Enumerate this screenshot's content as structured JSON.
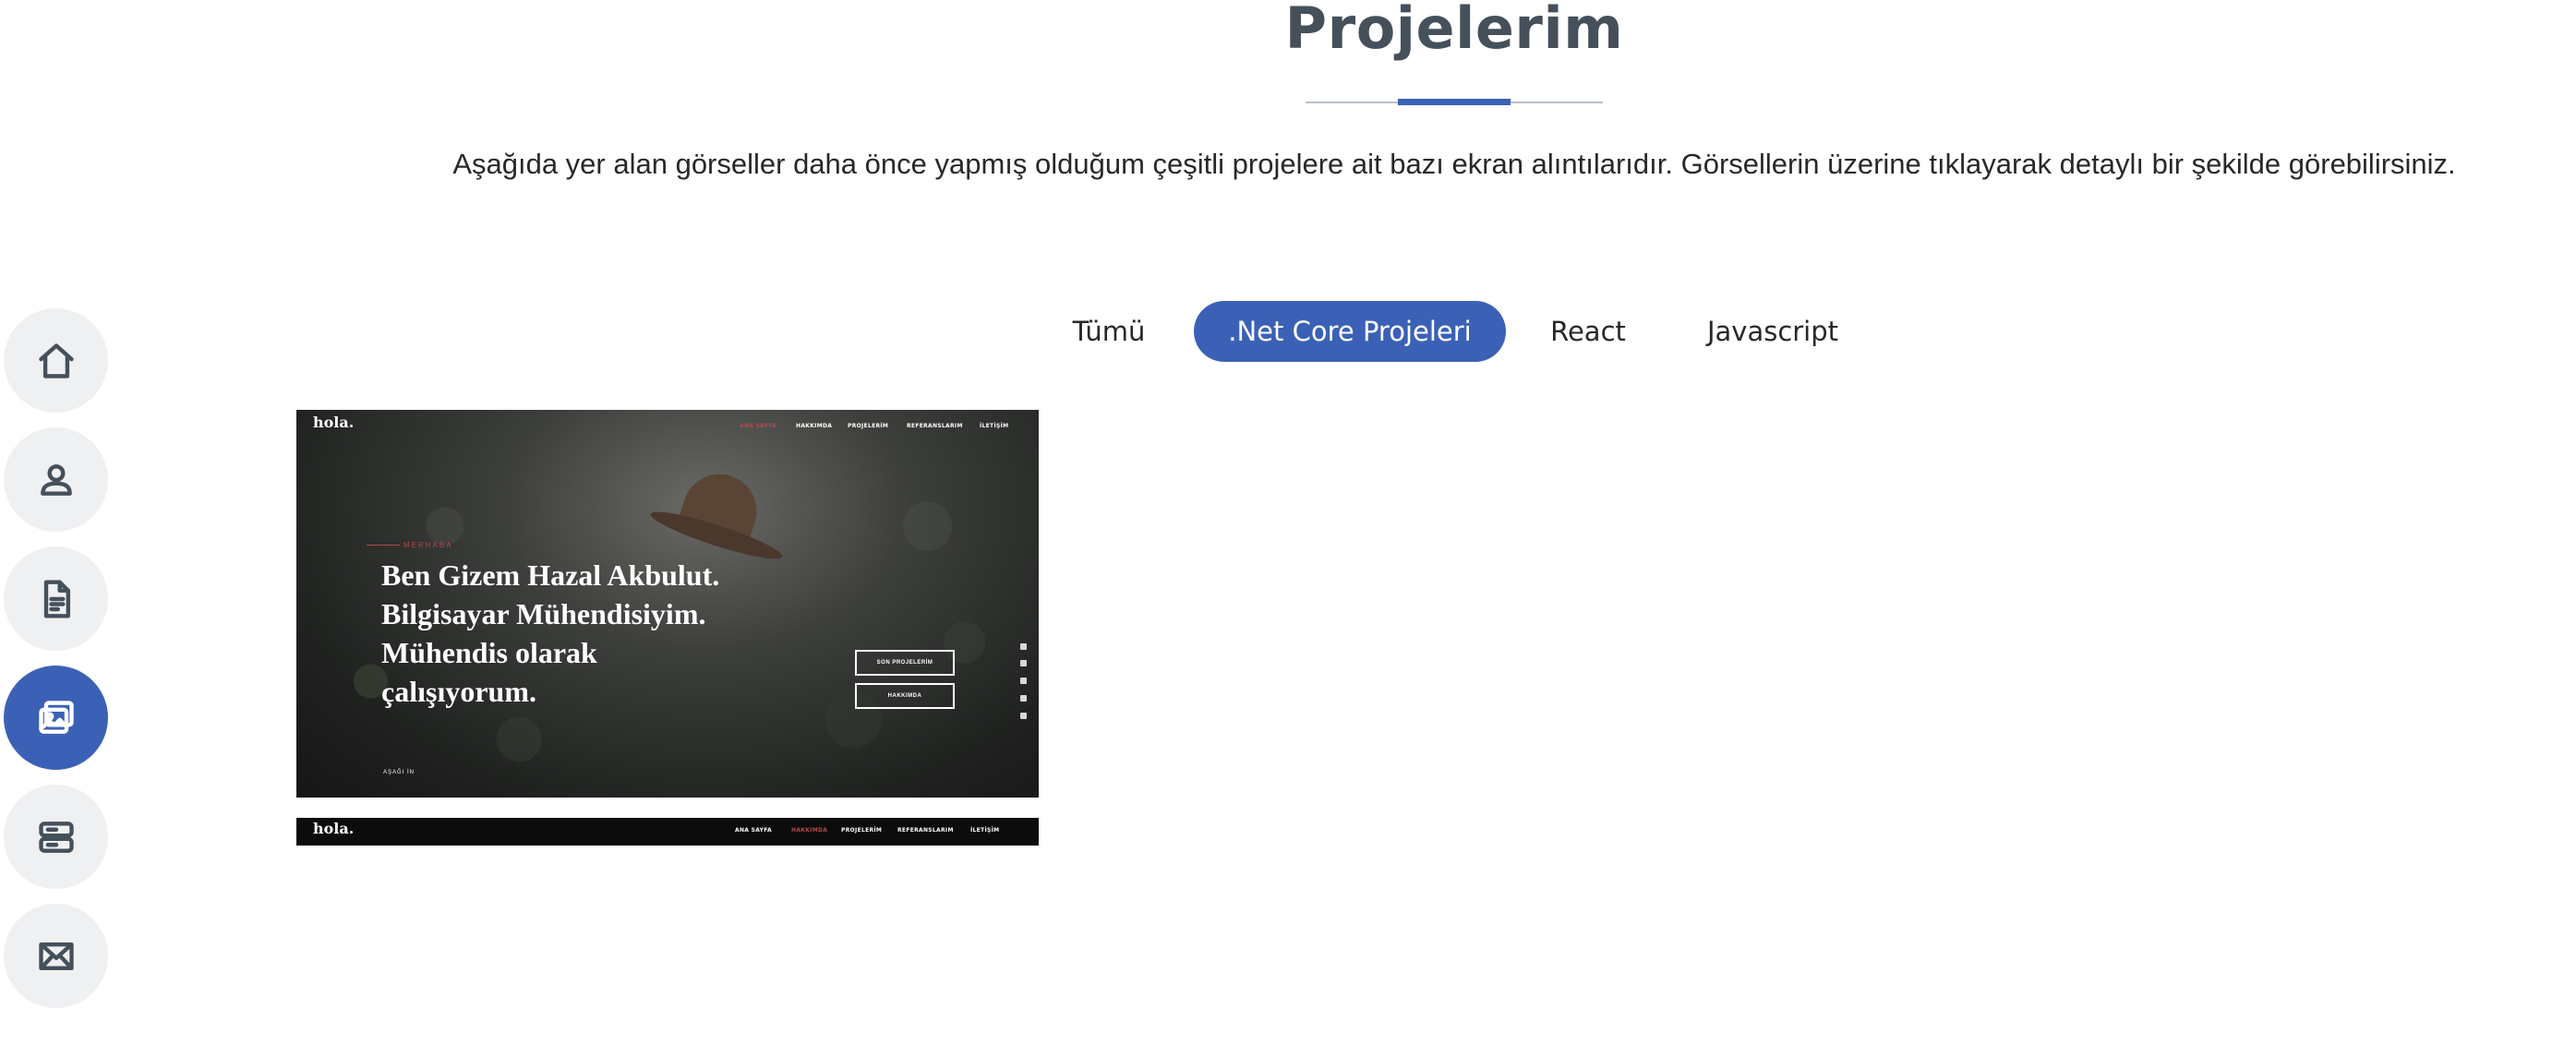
{
  "section": {
    "title": "Projelerim",
    "description": "Aşağıda yer alan görseller daha önce yapmış olduğum çeşitli projelere ait bazı ekran alıntılarıdır. Görsellerin üzerine tıklayarak detaylı bir şekilde görebilirsiniz."
  },
  "nav": {
    "items": [
      {
        "icon": "house-icon",
        "active": false
      },
      {
        "icon": "person-icon",
        "active": false
      },
      {
        "icon": "document-icon",
        "active": false
      },
      {
        "icon": "images-icon",
        "active": true
      },
      {
        "icon": "server-icon",
        "active": false
      },
      {
        "icon": "envelope-icon",
        "active": false
      }
    ]
  },
  "filters": {
    "items": [
      {
        "label": "Tümü",
        "active": false
      },
      {
        "label": ".Net Core Projeleri",
        "active": true
      },
      {
        "label": "React",
        "active": false
      },
      {
        "label": "Javascript",
        "active": false
      }
    ]
  },
  "project": {
    "logo": "hola.",
    "nav_items": [
      "ANA SAYFA",
      "HAKKIMDA",
      "PROJELERİM",
      "REFERANSLARIM",
      "İLETİŞİM"
    ],
    "kicker": "MERHABA",
    "hero_text": "Ben Gizem Hazal Akbulut. Bilgisayar Mühendisiyim. Mühendis olarak çalışıyorum.",
    "hero_lines": [
      "Ben Gizem Hazal Akbulut.",
      "Bilgisayar Mühendisiyim.",
      "Mühendis olarak",
      "çalışıyorum."
    ],
    "buttons": [
      "SON PROJELERİM",
      "HAKKIMDA"
    ],
    "scroll_label": "AŞAĞI İN",
    "second_logo": "hola.",
    "second_nav_items": [
      "ANA SAYFA",
      "HAKKIMDA",
      "PROJELERİM",
      "REFERANSLARIM",
      "İLETİŞİM"
    ]
  },
  "colors": {
    "accent": "#3b61b6",
    "heading": "#45505b",
    "nav_bg": "#eef0f2"
  }
}
